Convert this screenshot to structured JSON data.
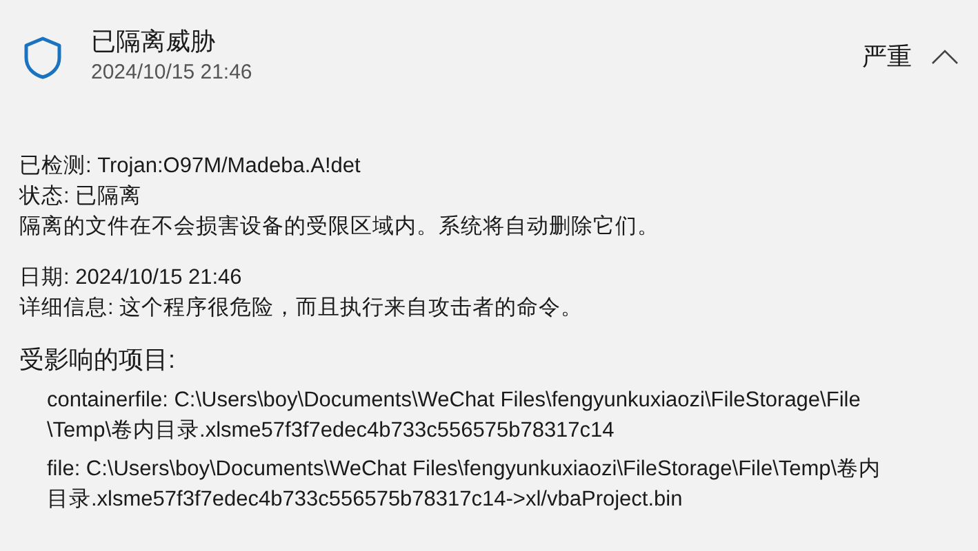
{
  "header": {
    "title": "已隔离威胁",
    "time": "2024/10/15 21:46",
    "severity": "严重",
    "expanded": true
  },
  "details": [
    {
      "label": "已检测:",
      "value": "Trojan:O97M/Madeba.A!det"
    },
    {
      "label": "状态:",
      "value": "已隔离"
    }
  ],
  "note": "隔离的文件在不会损害设备的受限区域内。系统将自动删除它们。",
  "details_2": [
    {
      "label": "日期:",
      "value": "2024/10/15 21:46"
    },
    {
      "label": "详细信息:",
      "value": "这个程序很危险，而且执行来自攻击者的命令。"
    }
  ],
  "affected": {
    "heading": "受影响的项目:",
    "items": [
      {
        "lines": [
          "containerfile: C:\\Users\\boy\\Documents\\WeChat Files\\fengyunkuxiaozi\\FileStorage\\File",
          "\\Temp\\卷内目录.xlsme57f3f7edec4b733c556575b78317c14"
        ]
      },
      {
        "lines": [
          "file: C:\\Users\\boy\\Documents\\WeChat Files\\fengyunkuxiaozi\\FileStorage\\File\\Temp\\卷内",
          "目录.xlsme57f3f7edec4b733c556575b78317c14->xl/vbaProject.bin"
        ]
      }
    ]
  }
}
